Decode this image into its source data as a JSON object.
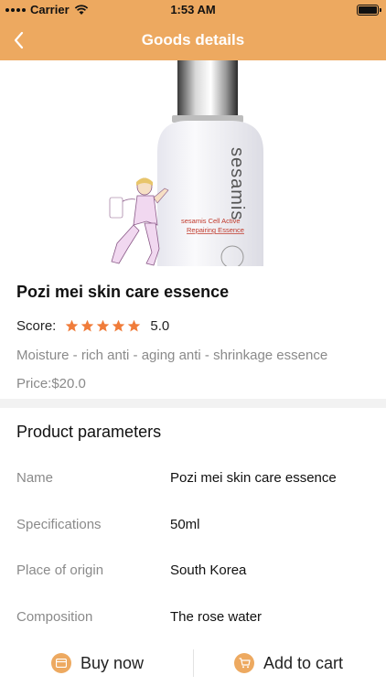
{
  "status": {
    "carrier": "Carrier",
    "time": "1:53 AM"
  },
  "nav": {
    "title": "Goods details"
  },
  "product": {
    "name": "Pozi mei skin care essence",
    "score_label": "Score:",
    "score_value": "5.0",
    "rating": 5,
    "description": "Moisture - rich anti - aging anti - shrinkage essence",
    "price": "Price:$20.0",
    "image_brand": "sesamis",
    "image_line1": "sesamis Cell Active",
    "image_line2": "Repairing Essence"
  },
  "params": {
    "title": "Product parameters",
    "rows": [
      {
        "key": "Name",
        "value": "Pozi mei skin care essence"
      },
      {
        "key": "Specifications",
        "value": "50ml"
      },
      {
        "key": "Place of origin",
        "value": "South Korea"
      },
      {
        "key": "Composition",
        "value": "The rose water"
      }
    ]
  },
  "actions": {
    "buy": "Buy now",
    "cart": "Add to cart"
  },
  "colors": {
    "accent": "#eda960",
    "star": "#f07c3a"
  }
}
